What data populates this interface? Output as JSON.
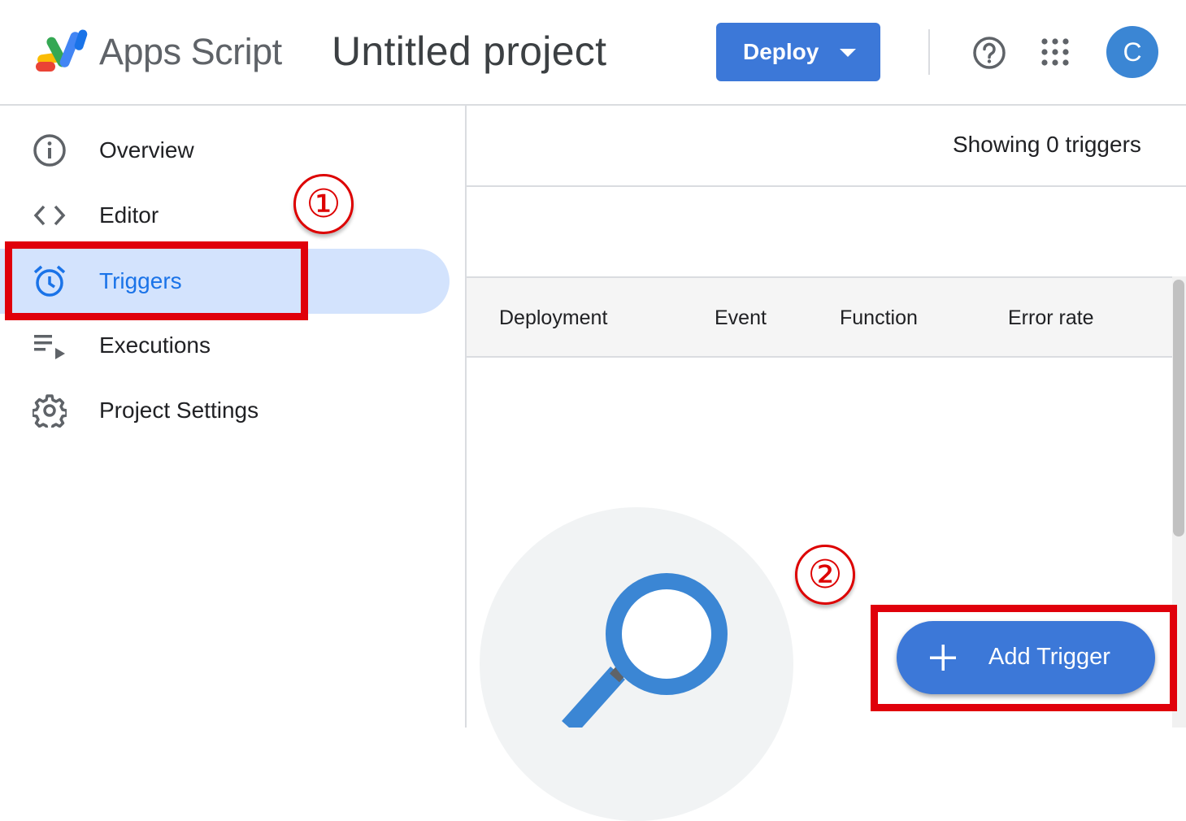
{
  "header": {
    "app_name": "Apps Script",
    "project_title": "Untitled project",
    "deploy_label": "Deploy",
    "avatar_letter": "C"
  },
  "sidebar": {
    "items": [
      {
        "label": "Overview",
        "icon": "info-icon"
      },
      {
        "label": "Editor",
        "icon": "code-brackets-icon"
      },
      {
        "label": "Triggers",
        "icon": "alarm-clock-icon",
        "active": true
      },
      {
        "label": "Executions",
        "icon": "playlist-play-icon"
      },
      {
        "label": "Project Settings",
        "icon": "gear-icon"
      }
    ]
  },
  "main": {
    "showing_text": "Showing 0 triggers",
    "columns": [
      "Deployment",
      "Event",
      "Function",
      "Error rate"
    ],
    "add_trigger_label": "Add Trigger"
  },
  "annotations": {
    "marker1": "①",
    "marker2": "②"
  },
  "colors": {
    "accent": "#3c78d8",
    "active_nav_bg": "#d3e3fd",
    "annotation_red": "#e0000b"
  }
}
